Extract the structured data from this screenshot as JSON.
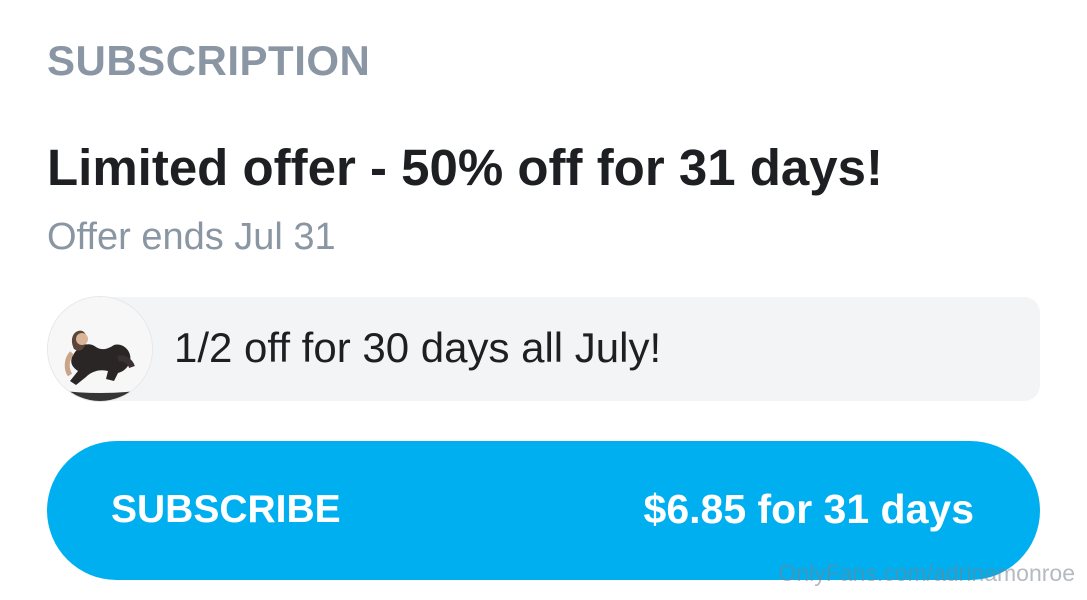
{
  "subscription": {
    "heading": "SUBSCRIPTION",
    "offer_title": "Limited offer - 50% off for 31 days!",
    "offer_ends": "Offer ends Jul 31"
  },
  "promo_message": {
    "text": "1/2 off for 30 days all July!",
    "avatar_icon": "profile-photo"
  },
  "subscribe_button": {
    "label": "SUBSCRIBE",
    "price": "$6.85 for 31 days",
    "color": "#00aff0"
  },
  "watermark": "OnlyFans.com/adrinamonroe"
}
